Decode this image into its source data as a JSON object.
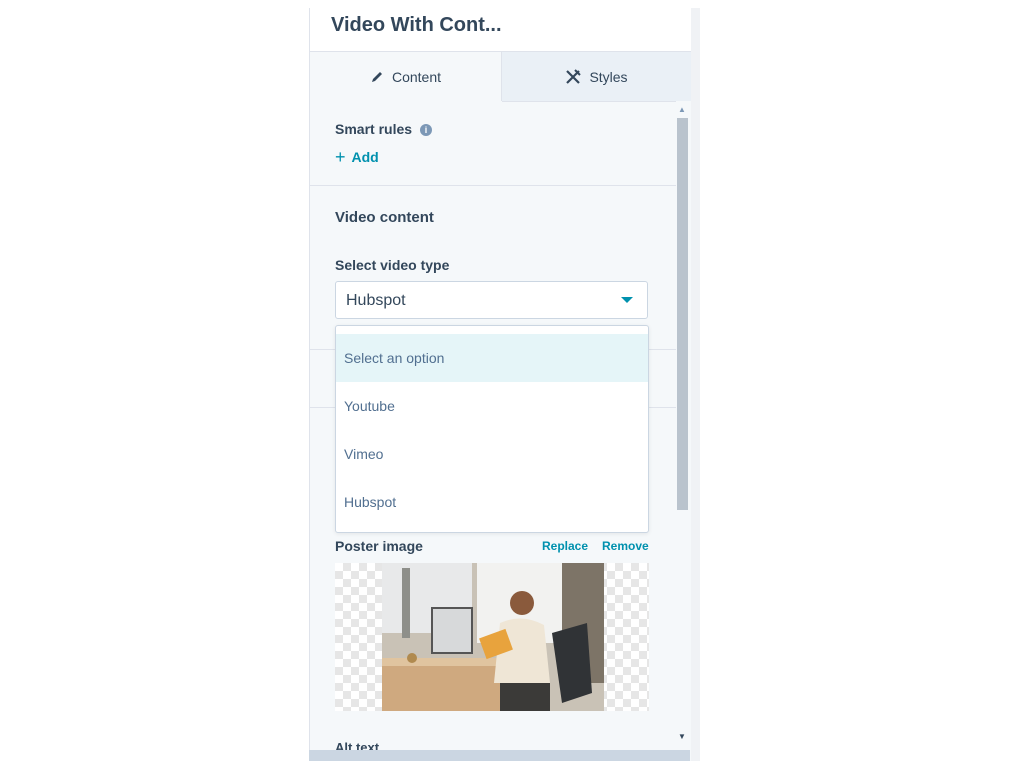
{
  "header": {
    "title": "Video With Cont..."
  },
  "tabs": [
    {
      "label": "Content",
      "icon": "pencil-icon",
      "active": true
    },
    {
      "label": "Styles",
      "icon": "styles-icon",
      "active": false
    }
  ],
  "smart_rules": {
    "label": "Smart rules",
    "add_label": "Add"
  },
  "video_content": {
    "heading": "Video content",
    "select_label": "Select video type",
    "selected_value": "Hubspot",
    "options": [
      "Select an option",
      "Youtube",
      "Vimeo",
      "Hubspot"
    ],
    "highlighted_option": "Select an option"
  },
  "poster_image": {
    "label": "Poster image",
    "replace_label": "Replace",
    "remove_label": "Remove"
  },
  "alt_text": {
    "label": "Alt text"
  },
  "colors": {
    "accent": "#0091ae",
    "text": "#33475b",
    "panel_bg": "#f5f8fa"
  }
}
